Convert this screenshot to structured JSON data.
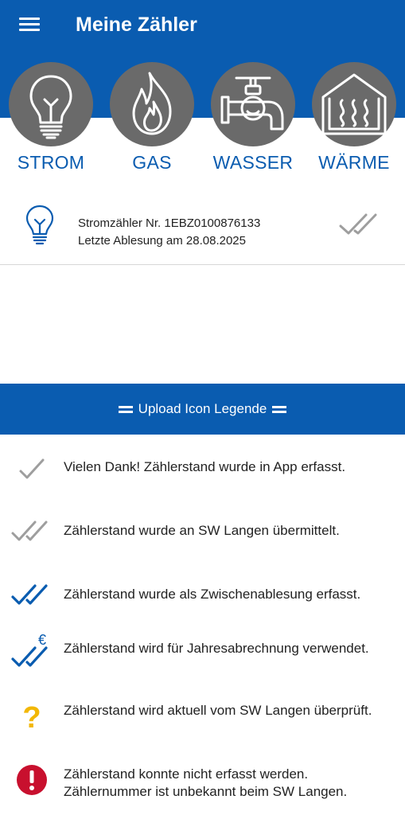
{
  "app": {
    "title": "Meine Zähler"
  },
  "types": [
    {
      "label": "STROM",
      "icon": "lightbulb-icon"
    },
    {
      "label": "GAS",
      "icon": "flame-icon"
    },
    {
      "label": "WASSER",
      "icon": "water-tap-icon"
    },
    {
      "label": "WÄRME",
      "icon": "house-heat-icon"
    }
  ],
  "meter": {
    "icon": "lightbulb-icon",
    "number_line": "Stromzähler Nr. 1EBZ0100876133",
    "reading_line": "Letzte Ablesung am 28.08.2025",
    "status_icon": "double-check-grey-icon"
  },
  "legend": {
    "title": "Upload Icon Legende",
    "items": [
      {
        "icon": "check-grey-icon",
        "text": "Vielen Dank! Zählerstand wurde in App erfasst."
      },
      {
        "icon": "double-check-grey-icon",
        "text": "Zählerstand wurde an SW Langen übermittelt."
      },
      {
        "icon": "double-check-blue-icon",
        "text": "Zählerstand wurde als Zwischenablesung erfasst."
      },
      {
        "icon": "double-check-euro-icon",
        "text": "Zählerstand wird für Jahresabrechnung verwendet."
      },
      {
        "icon": "question-mark-icon",
        "text": "Zählerstand wird aktuell vom SW Langen überprüft."
      },
      {
        "icon": "error-exclamation-icon",
        "text": "Zählerstand konnte nicht erfasst werden. Zählernummer ist unbekannt beim SW Langen."
      }
    ]
  },
  "colors": {
    "primary": "#0a5cb0",
    "icon_circle": "#6a6a6a",
    "check_grey": "#9e9e9e",
    "question": "#f2b705",
    "error": "#c8102e"
  }
}
